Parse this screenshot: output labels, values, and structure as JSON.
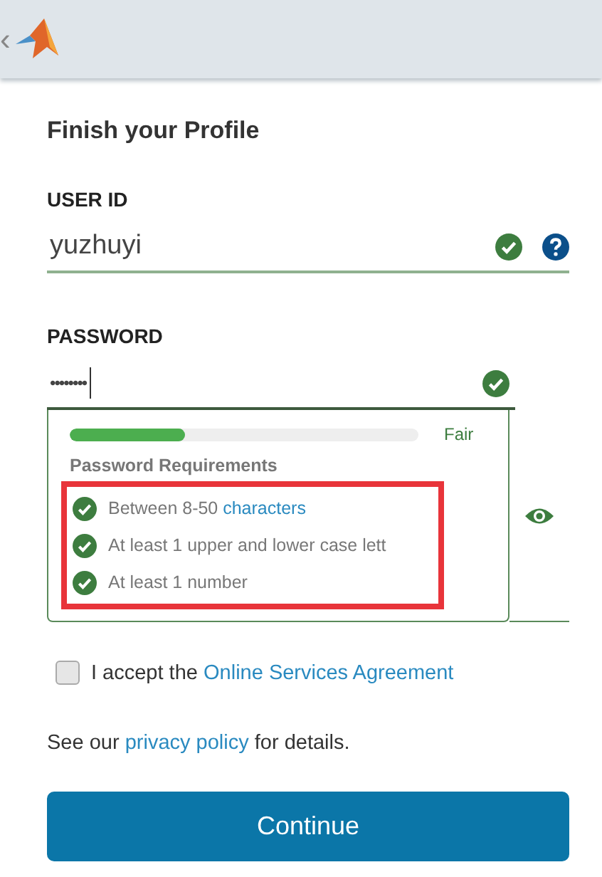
{
  "header": {
    "back": "‹"
  },
  "title": "Finish your Profile",
  "user_id": {
    "label": "USER ID",
    "value": "yuzhuyi",
    "valid": true
  },
  "password": {
    "label": "PASSWORD",
    "value": "••••••••",
    "valid": true,
    "strength": {
      "level": 0.33,
      "reading": "Fair"
    },
    "requirements_title": "Password Requirements",
    "requirements": [
      {
        "parts": [
          "Between 8-50 ",
          "characters"
        ],
        "met": true
      },
      {
        "parts": [
          "At least 1 upper and lower case lett"
        ],
        "met": true
      },
      {
        "parts": [
          "At least 1 number"
        ],
        "met": true
      }
    ]
  },
  "agreement": {
    "checked": false,
    "text": "I accept the ",
    "link": "Online Services Agreement"
  },
  "privacy": {
    "before": "See our ",
    "link": "privacy policy",
    "after": " for details."
  },
  "button": "Continue"
}
